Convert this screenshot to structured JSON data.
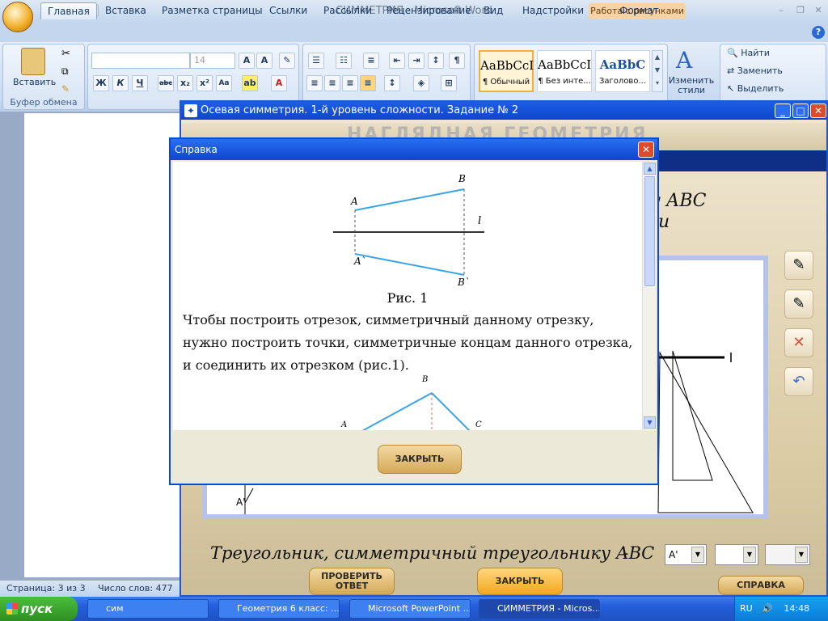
{
  "word": {
    "title": "СИММЕТРИЯ - Microsoft Word",
    "context_group": "Работа с рисунками",
    "tabs": [
      "Главная",
      "Вставка",
      "Разметка страницы",
      "Ссылки",
      "Рассылки",
      "Рецензирование",
      "Вид",
      "Надстройки",
      "Формат"
    ],
    "paste_label": "Вставить",
    "clipboard_label": "Буфер обмена",
    "font_size": "14",
    "styles": [
      {
        "preview": "AaBbCcI",
        "name": "¶ Обычный"
      },
      {
        "preview": "AaBbCcI",
        "name": "¶ Без инте..."
      },
      {
        "preview": "AaBbC",
        "name": "Заголово..."
      }
    ],
    "change_styles": "Изменить стили",
    "find": "Найти",
    "replace": "Заменить",
    "select": "Выделить",
    "status_page": "Страница: 3 из 3",
    "status_words": "Число слов: 477"
  },
  "app": {
    "title": "Осевая симметрия. 1-й уровень сложности. Задание № 2",
    "banner": "НАГЛЯДНАЯ ГЕОМЕТРИЯ",
    "task_fragment_1": "у АВС",
    "task_fragment_2": "и",
    "answer_prompt": "Треугольник, симметричный треугольнику АВС",
    "dash": "-",
    "select_value": "A'",
    "point_label": "A'",
    "check_button": "ПРОВЕРИТЬ ОТВЕТ",
    "close_button": "ЗАКРЫТЬ",
    "help_button": "СПРАВКА"
  },
  "dialog": {
    "title": "Справка",
    "fig_caption": "Рис. 1",
    "text": "Чтобы построить отрезок, симметричный данному отрезку, нужно построить точки, симметричные концам данного отрезка, и соединить их отрезком (рис.1).",
    "labels": {
      "A": "A",
      "B": "B",
      "A1": "A`",
      "B1": "B`",
      "l": "l",
      "B2": "B",
      "A2": "A",
      "C2": "C"
    },
    "close_label": "ЗАКРЫТЬ"
  },
  "taskbar": {
    "start": "пуск",
    "items": [
      "сим",
      "Геометрия 6 класс: ...",
      "Microsoft PowerPoint ...",
      "СИММЕТРИЯ - Micros..."
    ],
    "lang": "RU",
    "time": "14:48"
  }
}
